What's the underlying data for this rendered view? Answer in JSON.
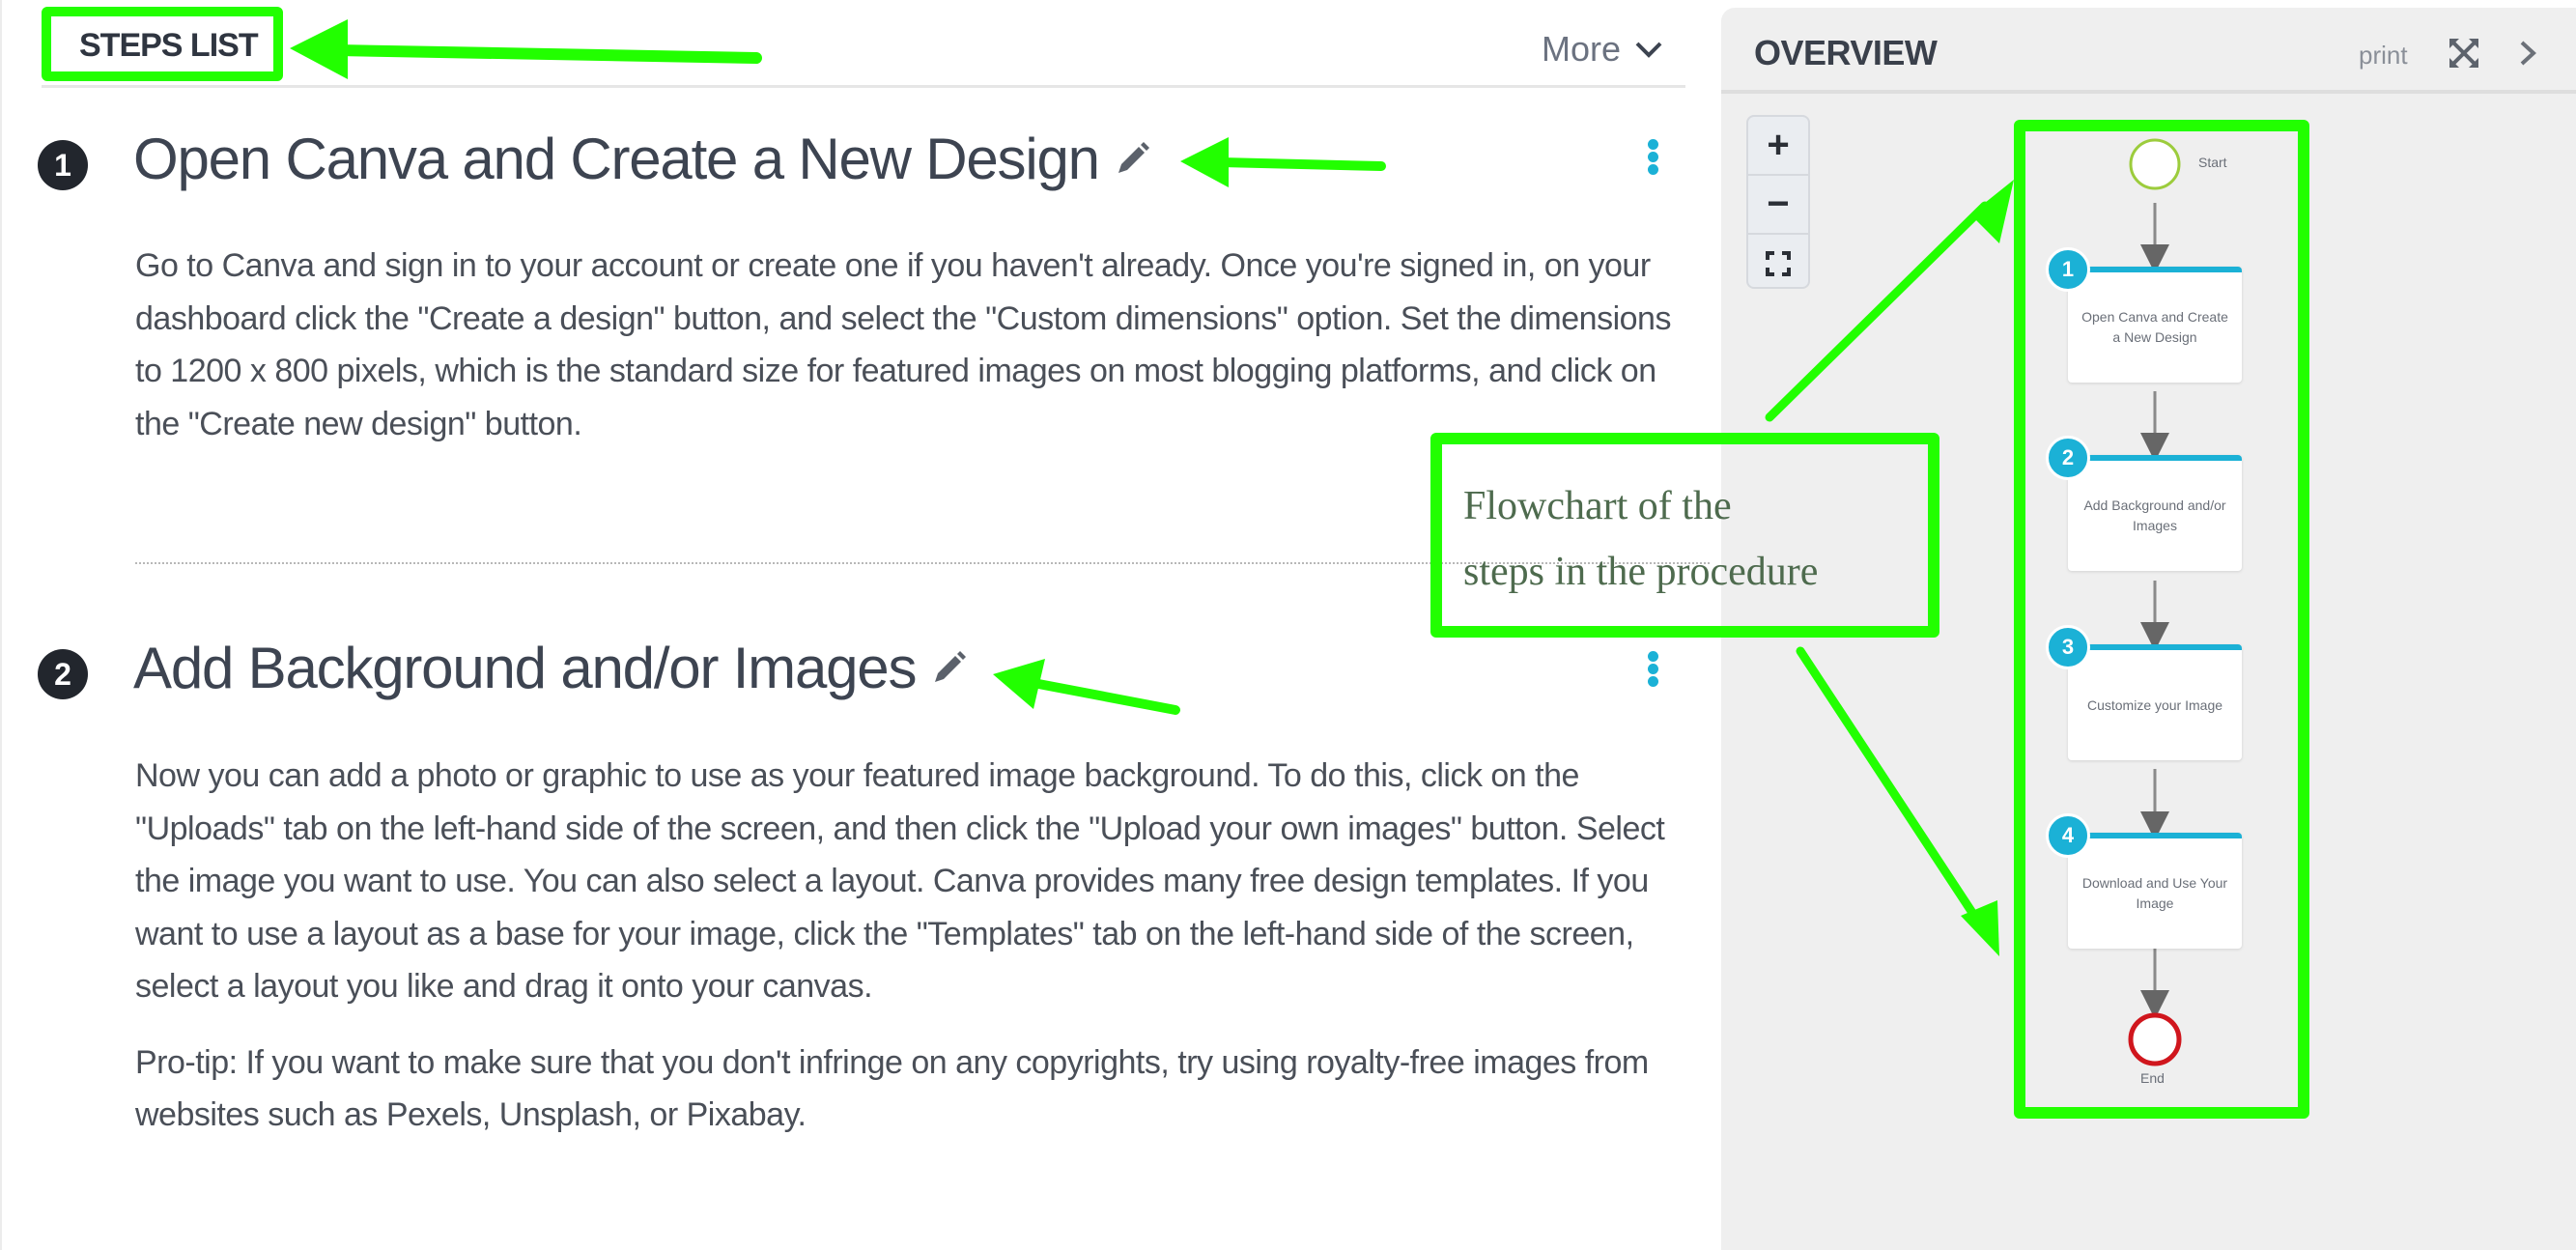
{
  "steps_panel": {
    "title": "STEPS LIST",
    "more_label": "More",
    "steps": [
      {
        "number": "1",
        "title": "Open Canva and Create a New Design",
        "paragraphs": [
          "Go to Canva and sign in to your account or create one if you haven't already. Once you're signed in, on your dashboard click the \"Create a design\" button, and select the \"Custom dimensions\" option. Set the dimensions to 1200 x 800 pixels, which is the standard size for featured images on most blogging platforms, and click on the \"Create new design\" button."
        ]
      },
      {
        "number": "2",
        "title": "Add Background and/or Images",
        "paragraphs": [
          "Now you can add a photo or graphic to use as your featured image background. To do this, click on the \"Uploads\" tab on the left-hand side of the screen, and then click the \"Upload your own images\" button. Select the image you want to use. You can also select a layout. Canva provides many free design templates. If you want to use a layout as a base for your image, click the \"Templates\" tab on the left-hand side of the screen, select a layout you like and drag it onto your canvas.",
          "Pro-tip: If you want to make sure that you don't infringe on any copyrights, try using royalty-free images from websites such as Pexels, Unsplash, or Pixabay."
        ]
      }
    ]
  },
  "overview_panel": {
    "title": "OVERVIEW",
    "print_label": "print",
    "zoom_controls": {
      "zoom_in": "+",
      "zoom_out": "−"
    },
    "flowchart": {
      "start_label": "Start",
      "end_label": "End",
      "nodes": [
        {
          "number": "1",
          "label": "Open Canva and Create a New Design"
        },
        {
          "number": "2",
          "label": "Add Background and/or Images"
        },
        {
          "number": "3",
          "label": "Customize your Image"
        },
        {
          "number": "4",
          "label": "Download and Use Your Image"
        }
      ]
    }
  },
  "annotation": {
    "line1": "Flowchart of the",
    "line2": "steps in the procedure"
  },
  "colors": {
    "accent": "#1bb1d6",
    "annotation_green": "#22ff00",
    "start_node": "#9ccc3c",
    "end_node": "#d0161d",
    "badge_dark": "#22262d"
  }
}
